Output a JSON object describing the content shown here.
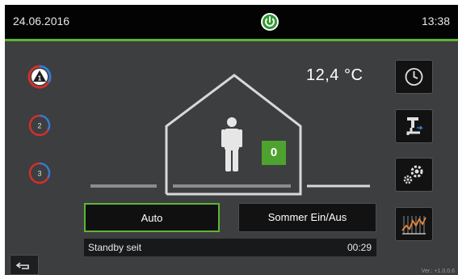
{
  "header": {
    "date": "24.06.2016",
    "time": "13:38",
    "power_status": "on",
    "power_icon": "power-icon",
    "accent_color": "#5fb434"
  },
  "heating_circuits": [
    {
      "number": "1",
      "active": true
    },
    {
      "number": "2",
      "active": false
    },
    {
      "number": "3",
      "active": false
    }
  ],
  "outdoor": {
    "temperature": "12,4 °C"
  },
  "house": {
    "occupant_icon": "person-icon",
    "badge_value": "0",
    "badge_color": "#4ea22e"
  },
  "right_menu": [
    {
      "icon": "clock-icon"
    },
    {
      "icon": "faucet-icon"
    },
    {
      "icon": "gears-icon"
    },
    {
      "icon": "chart-icon"
    }
  ],
  "modes": {
    "auto_label": "Auto",
    "sommer_label": "Sommer Ein/Aus"
  },
  "status": {
    "text": "Standby seit",
    "time": "00:29"
  },
  "footer": {
    "back_icon": "back-arrow-icon",
    "version": "Ver.: +1.0.0.6"
  }
}
